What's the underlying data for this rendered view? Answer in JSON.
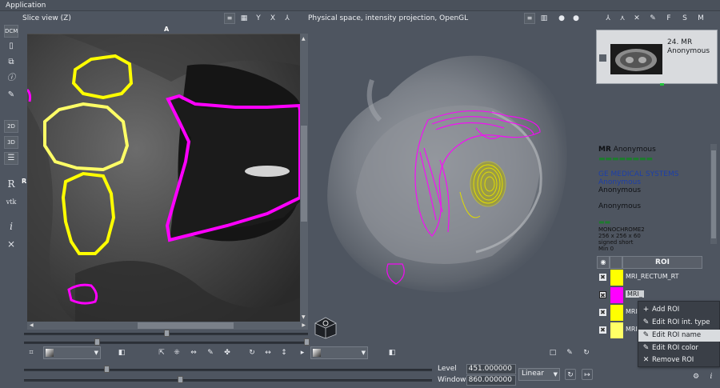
{
  "app": {
    "title": "Application"
  },
  "slice_view": {
    "title": "Slice view (Z)",
    "orient_top": "A",
    "orient_left": "R",
    "header_buttons": [
      "Y",
      "X"
    ]
  },
  "view3d": {
    "title": "Physical space, intensity projection, OpenGL"
  },
  "left_tools": {
    "dcm": "DCM",
    "b2d": "2D",
    "b3d": "3D",
    "r": "R",
    "vtk": "vtk",
    "info": "i",
    "close": "×"
  },
  "right_toolbar": {
    "f": "F",
    "s": "S",
    "m": "M"
  },
  "series": {
    "title": "24. MR",
    "subtitle": "Anonymous"
  },
  "info": {
    "modality": "MR",
    "patient": "Anonymous",
    "manufacturer": "GE MEDICAL SYSTEMS",
    "institution": "Anonymous",
    "physician": "Anonymous",
    "operator": "Anonymous",
    "color_scheme": "MONOCHROME2",
    "dims": "256 x 256 x 60",
    "pixel_type": "signed short",
    "min": "Min 0"
  },
  "roi_table": {
    "header": "ROI",
    "rows": [
      {
        "name": "MRI_RECTUM_RT",
        "color": "#ffff00"
      },
      {
        "name": "MRI_",
        "color": "#ff00ff"
      },
      {
        "name": "MRI",
        "color": "#ffff00"
      },
      {
        "name": "MRI",
        "color": "#ffff66"
      }
    ]
  },
  "context_menu": {
    "items": [
      {
        "label": "Add ROI",
        "icon": "plus-icon"
      },
      {
        "label": "Edit ROI int. type",
        "icon": "pencil-icon"
      },
      {
        "label": "Edit ROI name",
        "icon": "pencil-icon",
        "highlighted": true
      },
      {
        "label": "Edit ROI color",
        "icon": "pencil-icon"
      },
      {
        "label": "Remove ROI",
        "icon": "close-icon"
      }
    ]
  },
  "window_level": {
    "level_label": "Level",
    "level_value": "451.000000",
    "window_label": "Window",
    "window_value": "860.000000",
    "lut": "Linear"
  },
  "colors": {
    "magenta": "#ff00ff",
    "yellow": "#ffff00"
  }
}
